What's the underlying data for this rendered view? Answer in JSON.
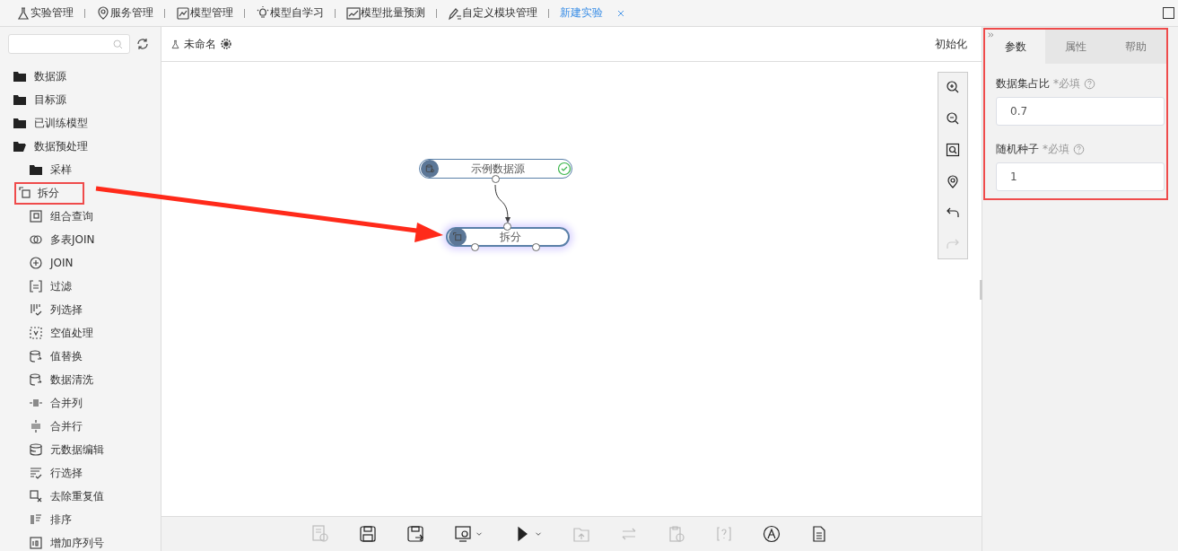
{
  "top_nav": [
    {
      "label": "实验管理",
      "selected": false
    },
    {
      "label": "服务管理",
      "selected": false
    },
    {
      "label": "模型管理",
      "selected": false
    },
    {
      "label": "模型自学习",
      "selected": false
    },
    {
      "label": "模型批量预测",
      "selected": false
    },
    {
      "label": "自定义模块管理",
      "selected": false
    },
    {
      "label": "新建实验",
      "selected": true
    }
  ],
  "sidebar": {
    "items": [
      {
        "kind": "folder",
        "label": "数据源",
        "expanded": false,
        "highlighted": false
      },
      {
        "kind": "folder",
        "label": "目标源",
        "expanded": false,
        "highlighted": false
      },
      {
        "kind": "folder",
        "label": "已训练模型",
        "expanded": false,
        "highlighted": false
      },
      {
        "kind": "folder",
        "label": "数据预处理",
        "expanded": true,
        "highlighted": false,
        "children": [
          {
            "kind": "folder",
            "label": "采样",
            "expanded": false,
            "highlighted": false
          },
          {
            "kind": "module",
            "label": "拆分",
            "highlighted": true
          },
          {
            "kind": "module",
            "label": "组合查询",
            "highlighted": false
          },
          {
            "kind": "module",
            "label": "多表JOIN",
            "highlighted": false
          },
          {
            "kind": "module",
            "label": "JOIN",
            "highlighted": false
          },
          {
            "kind": "module",
            "label": "过滤",
            "highlighted": false
          },
          {
            "kind": "module",
            "label": "列选择",
            "highlighted": false
          },
          {
            "kind": "module",
            "label": "空值处理",
            "highlighted": false
          },
          {
            "kind": "module",
            "label": "值替换",
            "highlighted": false
          },
          {
            "kind": "module",
            "label": "数据清洗",
            "highlighted": false
          },
          {
            "kind": "module",
            "label": "合并列",
            "highlighted": false
          },
          {
            "kind": "module",
            "label": "合并行",
            "highlighted": false
          },
          {
            "kind": "module",
            "label": "元数据编辑",
            "highlighted": false
          },
          {
            "kind": "module",
            "label": "行选择",
            "highlighted": false
          },
          {
            "kind": "module",
            "label": "去除重复值",
            "highlighted": false
          },
          {
            "kind": "module",
            "label": "排序",
            "highlighted": false
          },
          {
            "kind": "module",
            "label": "增加序列号",
            "highlighted": false
          }
        ]
      }
    ]
  },
  "canvas": {
    "title": "未命名",
    "init_button": "初始化",
    "nodes": [
      {
        "label": "示例数据源",
        "validated": true,
        "selected": false
      },
      {
        "label": "拆分",
        "validated": false,
        "selected": true
      }
    ],
    "zoom_tools": [
      {
        "disabled": false
      },
      {
        "disabled": false
      },
      {
        "disabled": false
      },
      {
        "disabled": false
      },
      {
        "disabled": false
      },
      {
        "disabled": true
      }
    ],
    "toolbar": [
      {
        "disabled": true,
        "dropdown": false
      },
      {
        "disabled": false,
        "dropdown": false
      },
      {
        "disabled": false,
        "dropdown": false
      },
      {
        "disabled": false,
        "dropdown": true
      },
      {
        "disabled": false,
        "dropdown": true
      },
      {
        "disabled": true,
        "dropdown": false
      },
      {
        "disabled": true,
        "dropdown": false
      },
      {
        "disabled": true,
        "dropdown": false
      },
      {
        "disabled": true,
        "dropdown": false
      },
      {
        "disabled": false,
        "dropdown": false
      },
      {
        "disabled": false,
        "dropdown": false
      }
    ]
  },
  "panel": {
    "highlighted": true,
    "tabs": [
      {
        "label": "参数",
        "selected": true
      },
      {
        "label": "属性",
        "selected": false
      },
      {
        "label": "帮助",
        "selected": false
      }
    ],
    "fields": [
      {
        "label": "数据集占比",
        "required": "*必填",
        "value": "0.7"
      },
      {
        "label": "随机种子",
        "required": "*必填",
        "value": "1"
      }
    ]
  }
}
